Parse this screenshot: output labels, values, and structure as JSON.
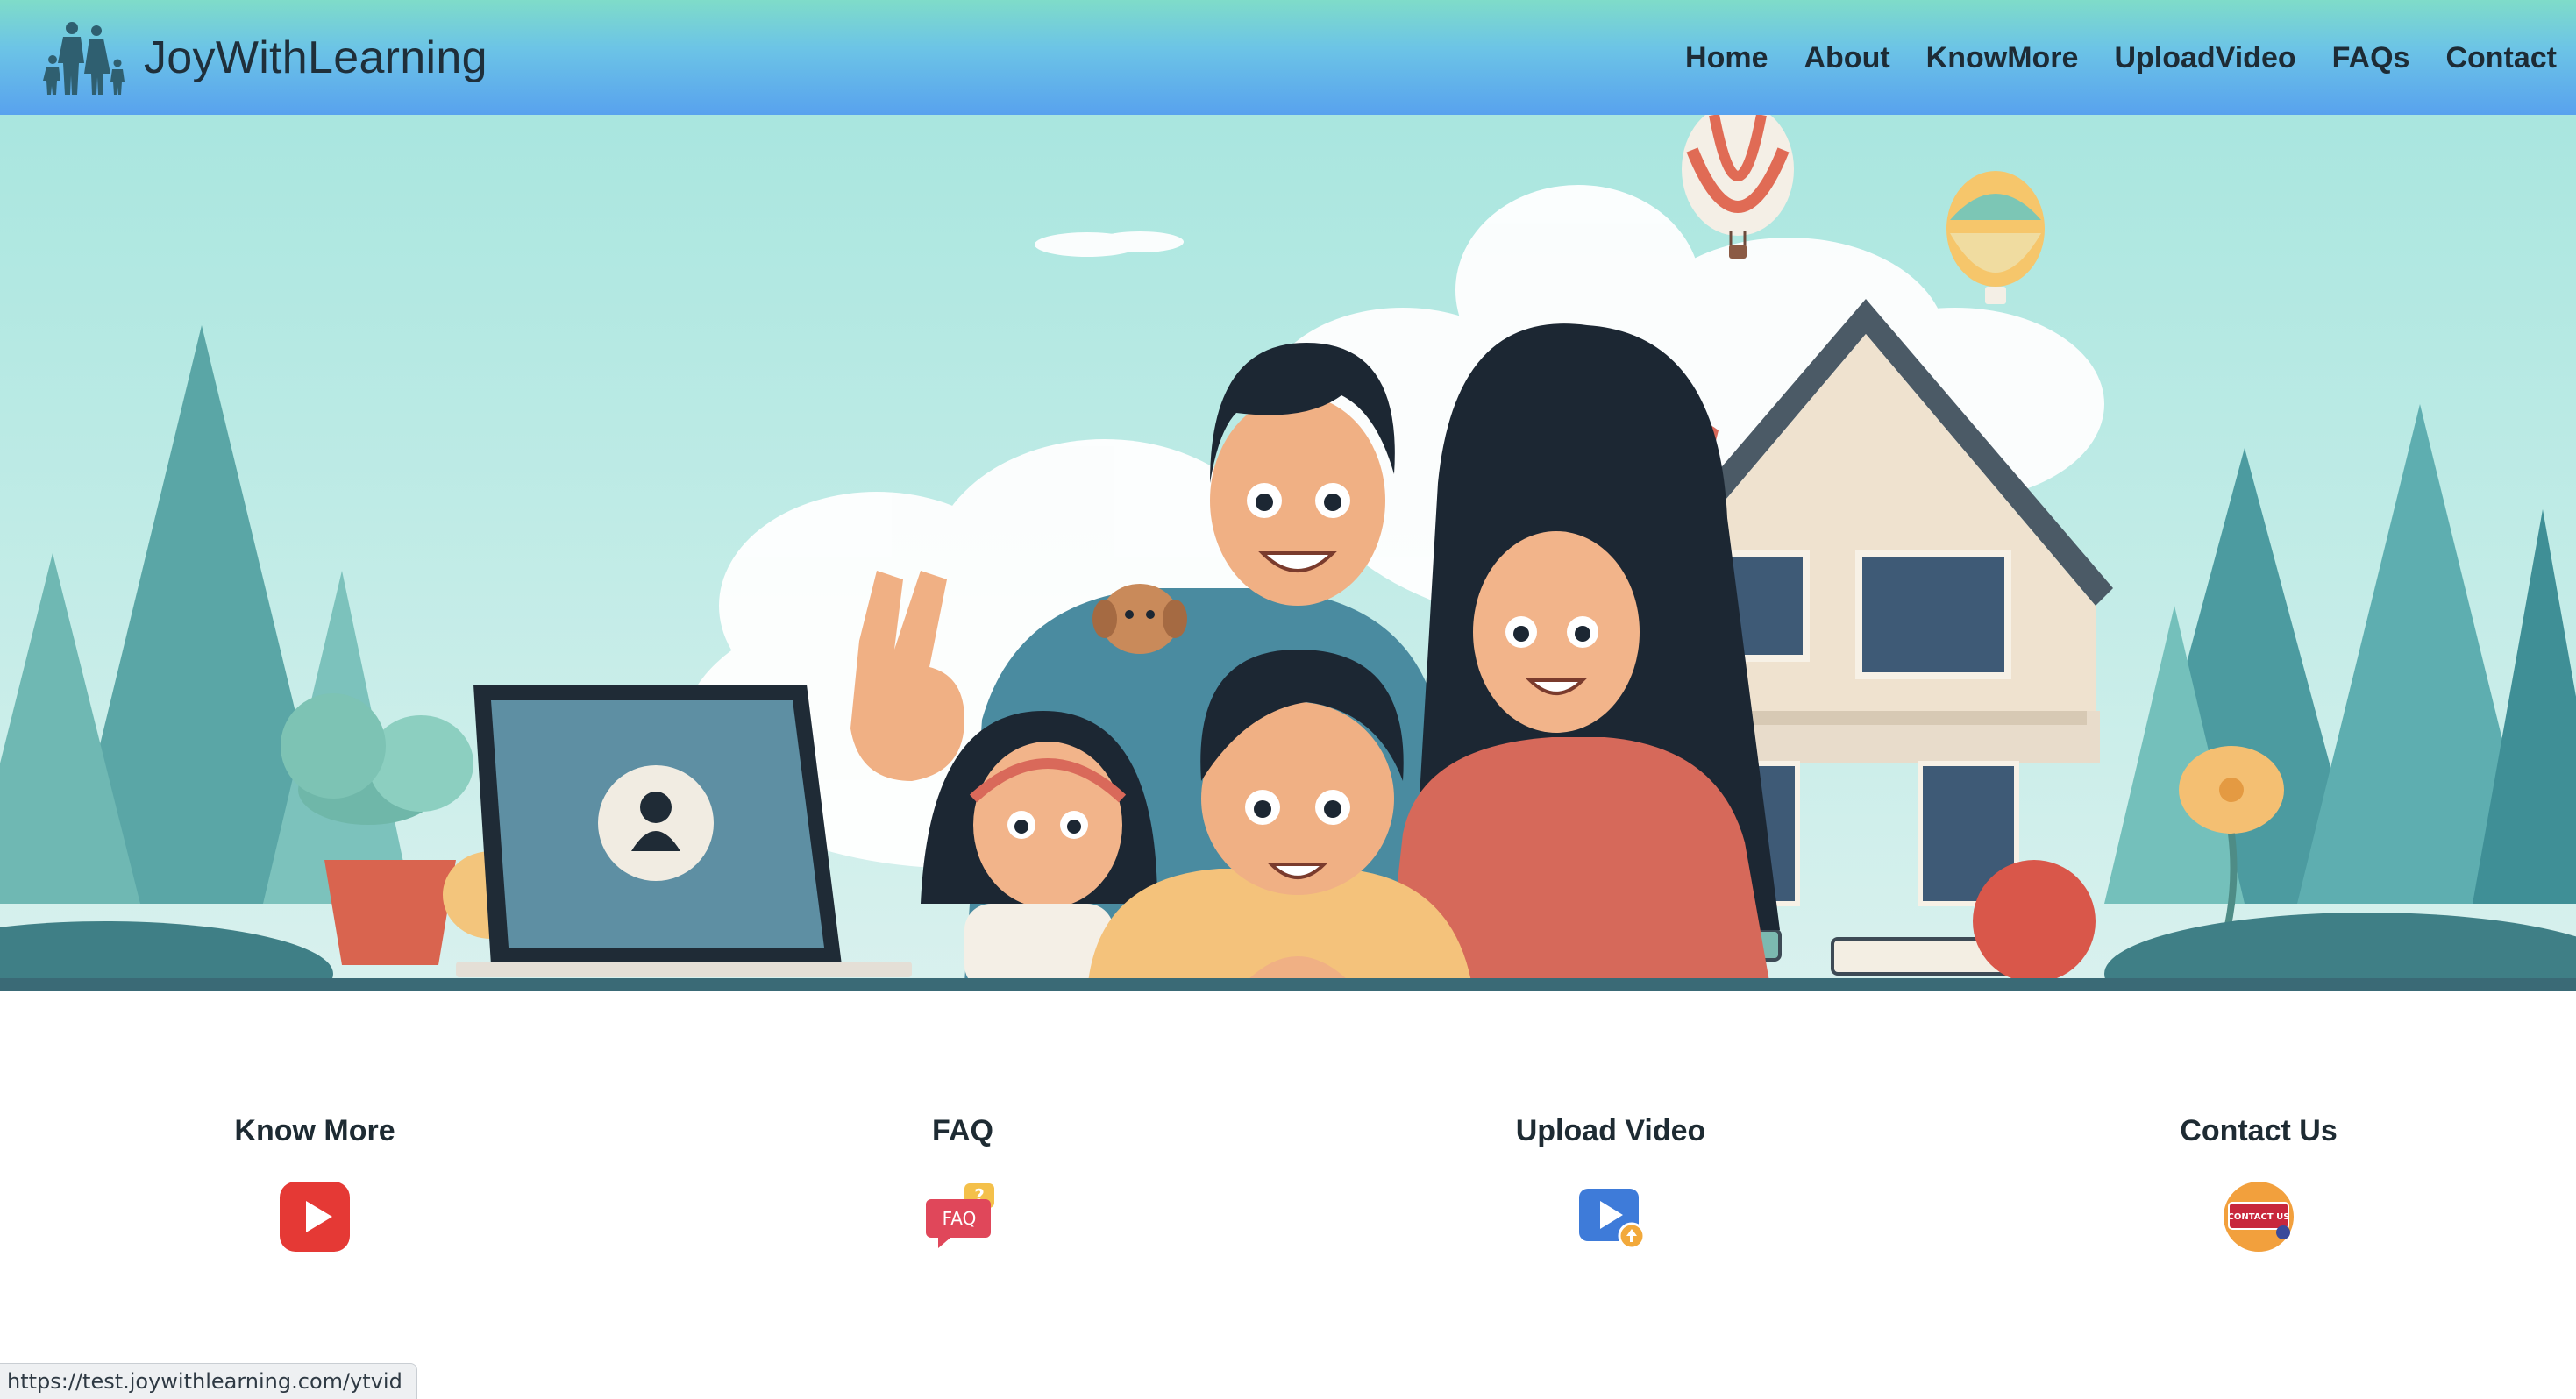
{
  "brand": {
    "name": "JoyWithLearning",
    "logo_icon": "family-silhouette-icon"
  },
  "nav": [
    {
      "label": "Home"
    },
    {
      "label": "About"
    },
    {
      "label": "KnowMore"
    },
    {
      "label": "UploadVideo"
    },
    {
      "label": "FAQs"
    },
    {
      "label": "Contact"
    }
  ],
  "hero": {
    "image": "family-illustration-with-laptop-and-house",
    "laptop_screen_icon": "user-avatar-icon"
  },
  "features": [
    {
      "title": "Know More",
      "icon": "youtube-play-icon"
    },
    {
      "title": "FAQ",
      "icon": "faq-speech-bubble-icon",
      "icon_text": "FAQ",
      "badge_text": "?"
    },
    {
      "title": "Upload Video",
      "icon": "video-upload-icon"
    },
    {
      "title": "Contact Us",
      "icon": "contact-us-badge-icon",
      "icon_text": "CONTACT US"
    }
  ],
  "status_bar": {
    "url": "https://test.joywithlearning.com/ytvid"
  },
  "colors": {
    "header_top": "#7fdcc9",
    "header_bottom": "#58a2ee",
    "hero_sky": "#bfe9e4",
    "youtube_red": "#e53935",
    "faq_red": "#e0475a",
    "upload_blue": "#3e7bd9",
    "contact_orange": "#f2a03d"
  }
}
